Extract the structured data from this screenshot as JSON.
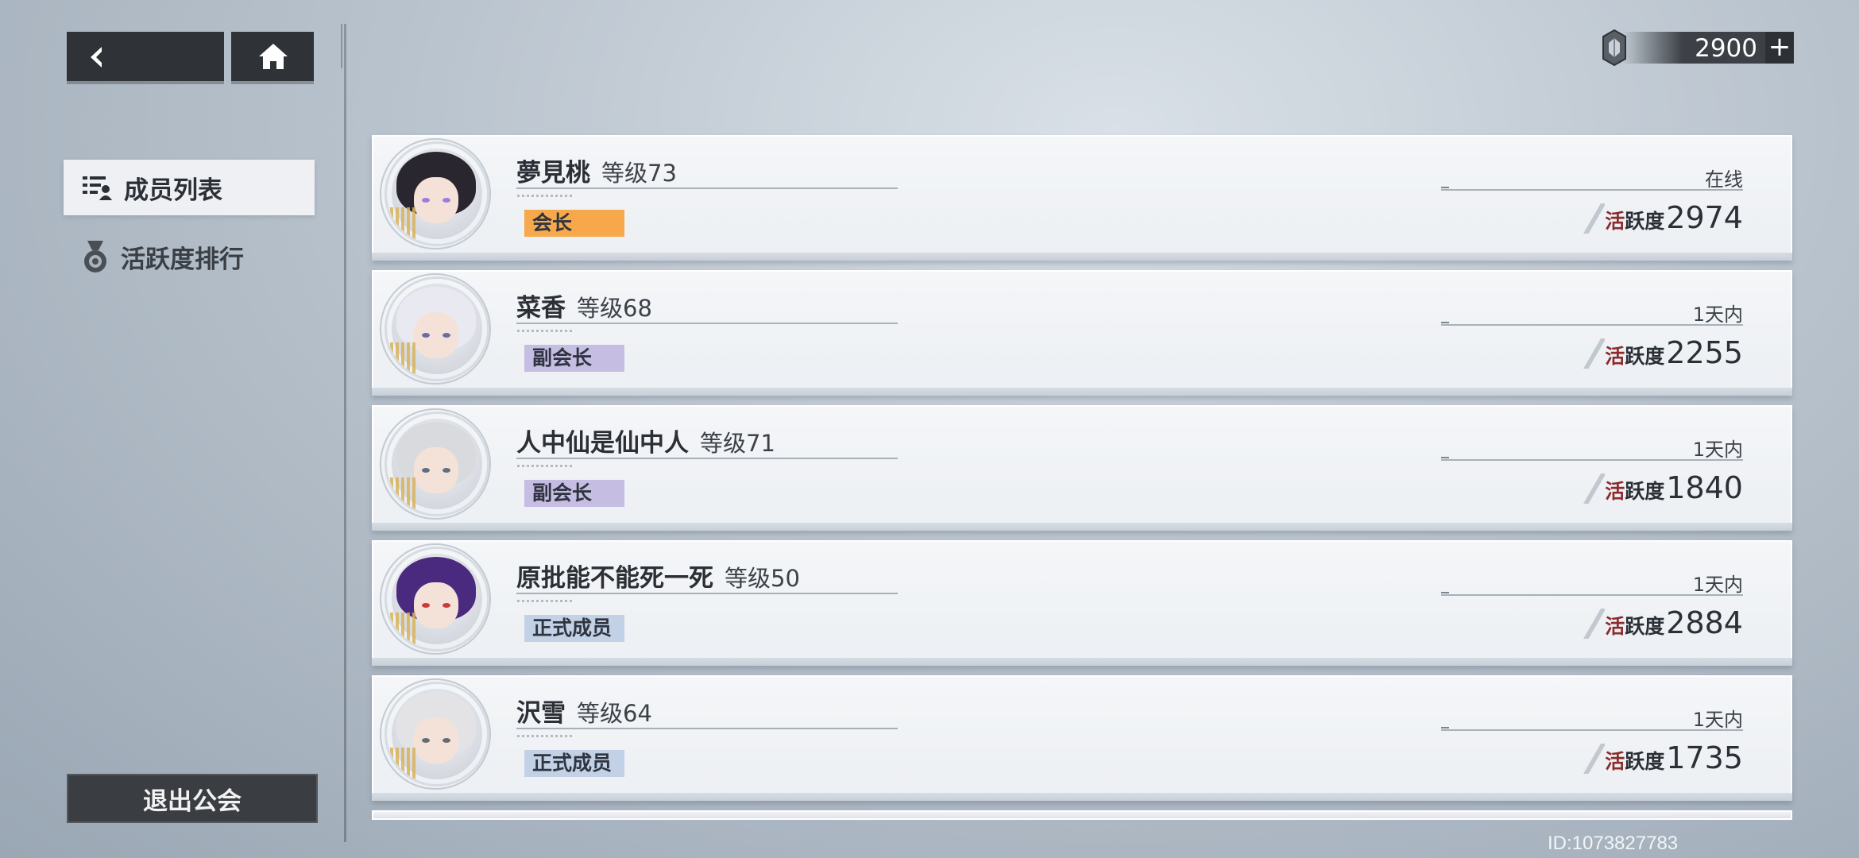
{
  "nav": {
    "back_icon": "chevron-left-icon",
    "home_icon": "home-icon"
  },
  "sidebar": {
    "items": [
      {
        "label": "成员列表",
        "icon": "member-list-icon",
        "active": true
      },
      {
        "label": "活跃度排行",
        "icon": "medal-icon",
        "active": false
      }
    ],
    "leave_label": "退出公会"
  },
  "currency": {
    "icon": "gem-icon",
    "amount": "2900",
    "plus": "+"
  },
  "members": [
    {
      "name": "夢見桃",
      "level": "等级73",
      "role": "会长",
      "role_color": "#f6a84a",
      "status": "在线",
      "activity_label": "活跃度",
      "activity_value": "2974",
      "hair": "#2a2630",
      "eye": "#9b7ce0"
    },
    {
      "name": "菜香",
      "level": "等级68",
      "role": "副会长",
      "role_color": "#c6bde3",
      "status": "1天内",
      "activity_label": "活跃度",
      "activity_value": "2255",
      "hair": "#e9eaf1",
      "eye": "#6c6ba8"
    },
    {
      "name": "人中仙是仙中人",
      "level": "等级71",
      "role": "副会长",
      "role_color": "#c6bde3",
      "status": "1天内",
      "activity_label": "活跃度",
      "activity_value": "1840",
      "hair": "#d9dadd",
      "eye": "#5f6f82"
    },
    {
      "name": "原批能不能死一死",
      "level": "等级50",
      "role": "正式成员",
      "role_color": "#c3d1e6",
      "status": "1天内",
      "activity_label": "活跃度",
      "activity_value": "2884",
      "hair": "#4a2a7e",
      "eye": "#c93a3a"
    },
    {
      "name": "沢雪",
      "level": "等级64",
      "role": "正式成员",
      "role_color": "#c3d1e6",
      "status": "1天内",
      "activity_label": "活跃度",
      "activity_value": "1735",
      "hair": "#e3e3e6",
      "eye": "#666a72"
    }
  ],
  "footer": {
    "id_text": "ID:1073827783"
  }
}
